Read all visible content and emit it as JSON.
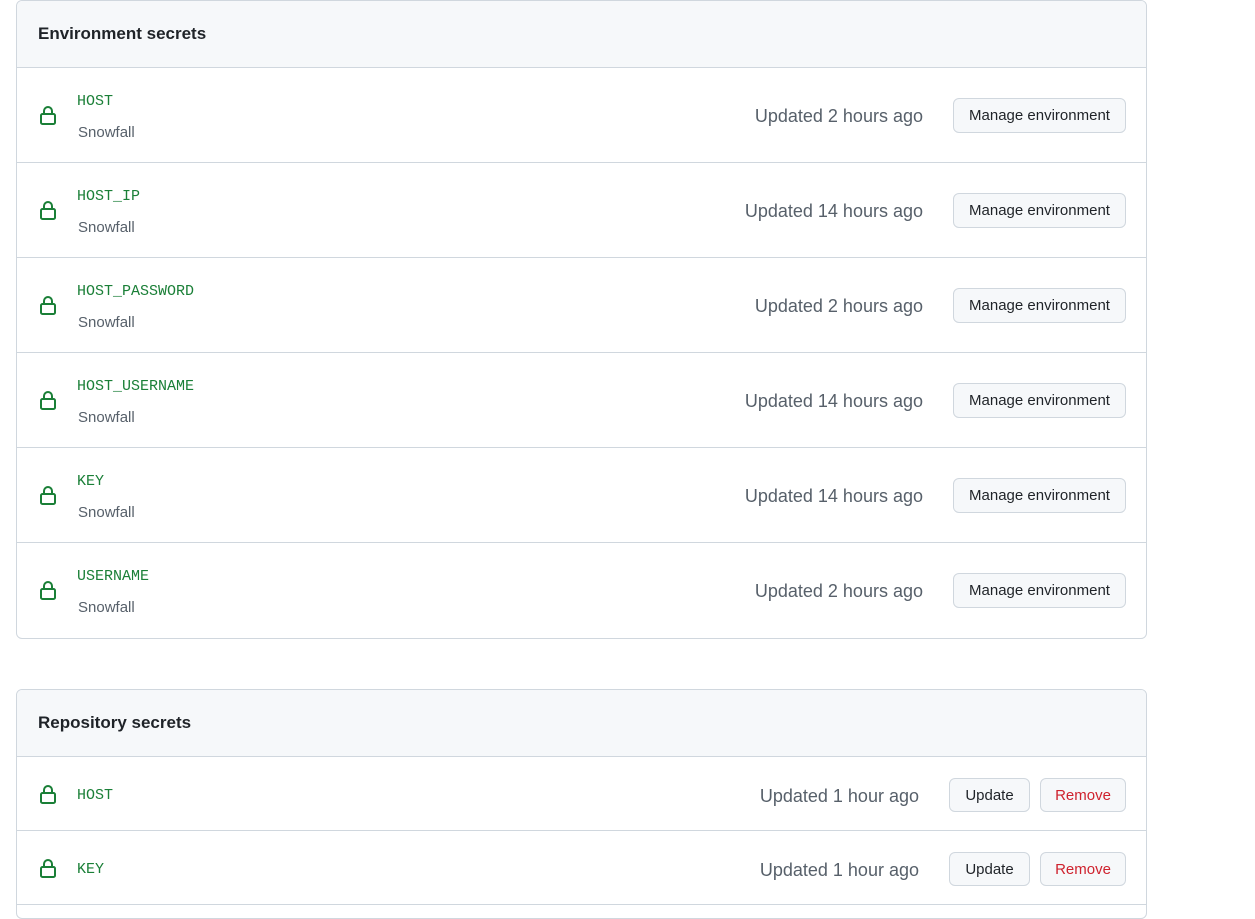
{
  "environment_secrets": {
    "title": "Environment secrets",
    "rows": [
      {
        "name": "HOST",
        "environment": "Snowfall",
        "updated": "Updated 2 hours ago",
        "button": "Manage environment"
      },
      {
        "name": "HOST_IP",
        "environment": "Snowfall",
        "updated": "Updated 14 hours ago",
        "button": "Manage environment"
      },
      {
        "name": "HOST_PASSWORD",
        "environment": "Snowfall",
        "updated": "Updated 2 hours ago",
        "button": "Manage environment"
      },
      {
        "name": "HOST_USERNAME",
        "environment": "Snowfall",
        "updated": "Updated 14 hours ago",
        "button": "Manage environment"
      },
      {
        "name": "KEY",
        "environment": "Snowfall",
        "updated": "Updated 14 hours ago",
        "button": "Manage environment"
      },
      {
        "name": "USERNAME",
        "environment": "Snowfall",
        "updated": "Updated 2 hours ago",
        "button": "Manage environment"
      }
    ]
  },
  "repository_secrets": {
    "title": "Repository secrets",
    "rows": [
      {
        "name": "HOST",
        "updated": "Updated 1 hour ago",
        "update_label": "Update",
        "remove_label": "Remove"
      },
      {
        "name": "KEY",
        "updated": "Updated 1 hour ago",
        "update_label": "Update",
        "remove_label": "Remove"
      }
    ]
  },
  "icons": {
    "secret": "lock-icon"
  },
  "colors": {
    "secret_name": "#1a7f37",
    "lock": "#1a7f37",
    "remove": "#cf222e",
    "muted": "#57606a",
    "border": "#d0d7de",
    "header_bg": "#f6f8fa"
  }
}
